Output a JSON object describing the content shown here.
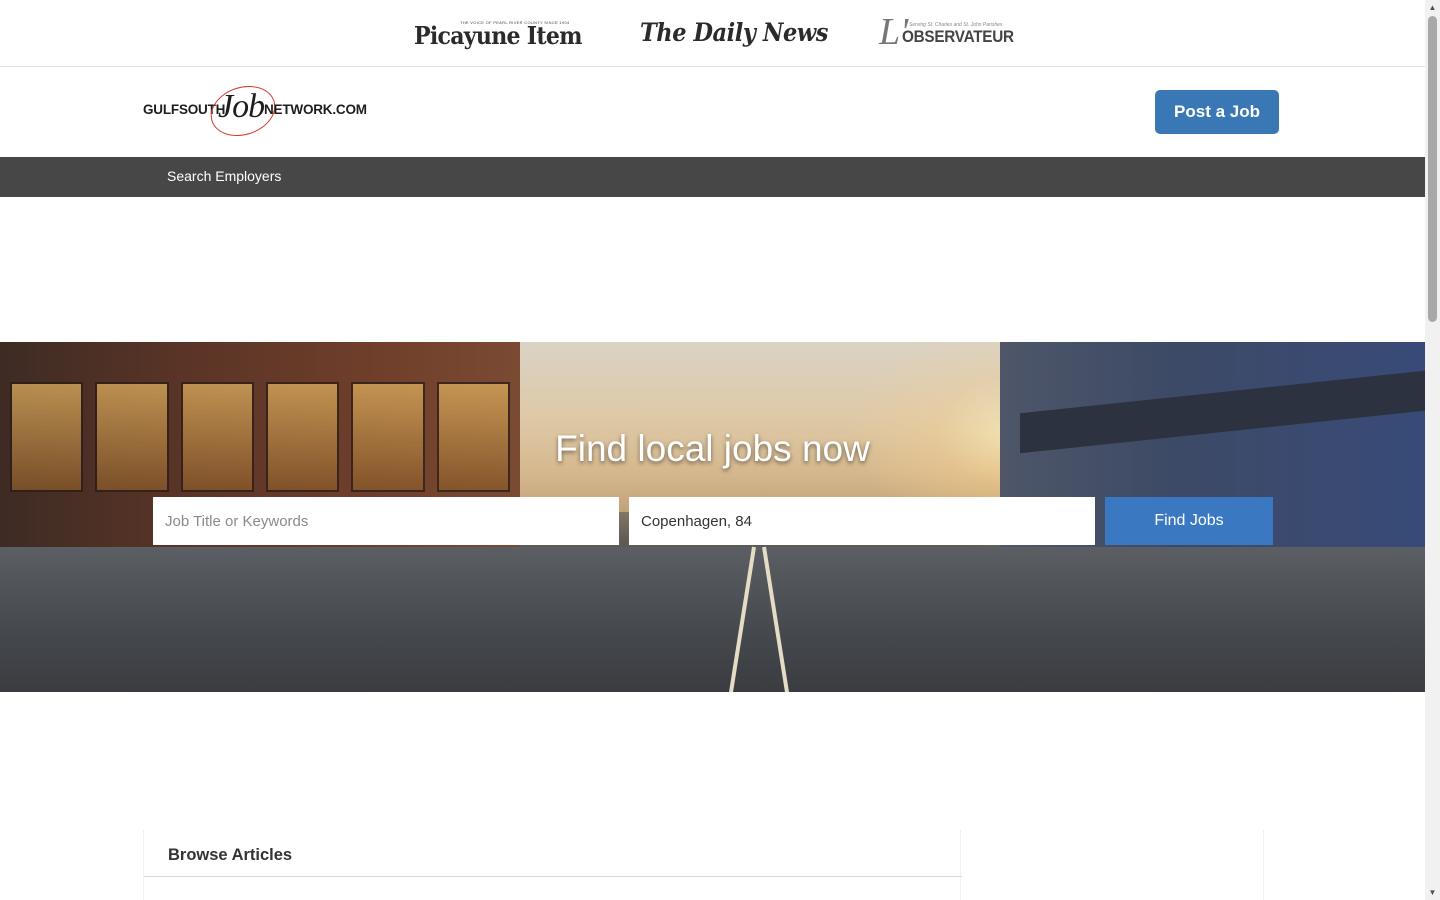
{
  "publications": {
    "picayune": {
      "name": "Picayune Item",
      "tagline": "THE VOICE OF PEARL RIVER COUNTY SINCE 1904"
    },
    "daily_news": {
      "name": "The Daily News"
    },
    "observateur": {
      "prefix": "L'",
      "name": "OBSERVATEUR",
      "tagline": "Serving St. Charles and St. John Parishes"
    }
  },
  "header": {
    "logo": {
      "left": "GULFSOUTH",
      "middle": "Job",
      "right": "NETWORK.COM"
    },
    "post_job_label": "Post a Job",
    "accent_color": "#3a78b5"
  },
  "nav": {
    "items": [
      {
        "label": "Search Employers"
      }
    ]
  },
  "hero": {
    "title": "Find local jobs now",
    "keywords_placeholder": "Job Title or Keywords",
    "location_value": "Copenhagen, 84",
    "find_label": "Find Jobs",
    "button_color": "#3a78c2"
  },
  "browse": {
    "title": "Browse Articles"
  },
  "icons": {
    "scroll_up": "scroll-up-icon",
    "scroll_down": "scroll-down-icon"
  }
}
